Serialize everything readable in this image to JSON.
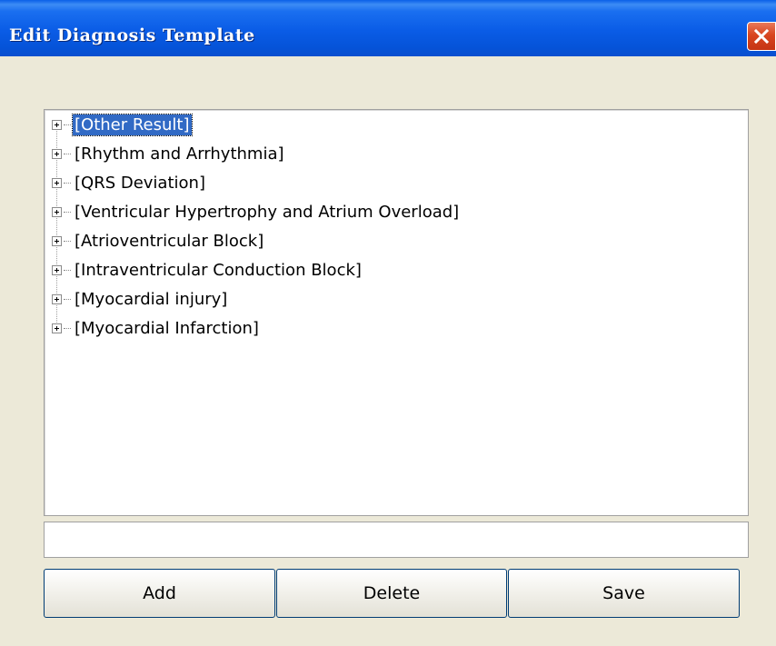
{
  "window": {
    "title": "Edit Diagnosis Template"
  },
  "tree": {
    "items": [
      {
        "label": "[Other Result]",
        "selected": true
      },
      {
        "label": "[Rhythm and Arrhythmia]",
        "selected": false
      },
      {
        "label": "[QRS Deviation]",
        "selected": false
      },
      {
        "label": "[Ventricular Hypertrophy and Atrium  Overload]",
        "selected": false
      },
      {
        "label": "[Atrioventricular Block]",
        "selected": false
      },
      {
        "label": "[Intraventricular Conduction Block]",
        "selected": false
      },
      {
        "label": "[Myocardial injury]",
        "selected": false
      },
      {
        "label": "[Myocardial Infarction]",
        "selected": false
      }
    ]
  },
  "input": {
    "value": ""
  },
  "buttons": {
    "add_label": "Add",
    "delete_label": "Delete",
    "save_label": "Save"
  },
  "colors": {
    "titlebar": "#0a5ce6",
    "selection": "#316ac5",
    "close": "#d8451f",
    "dialog_bg": "#ece9d8"
  },
  "icons": {
    "close": "close-icon",
    "expander": "plus-expander-icon"
  }
}
